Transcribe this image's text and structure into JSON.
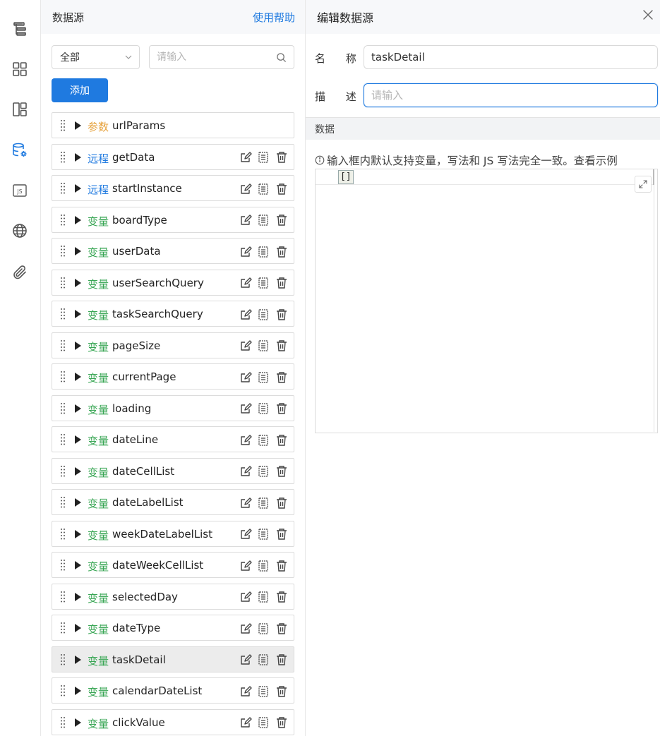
{
  "rail": {
    "icons": [
      "outline-tree-icon",
      "components-grid-icon",
      "layout-icon",
      "datasource-icon",
      "js-icon",
      "globe-icon",
      "attachment-icon"
    ],
    "active": "datasource-icon",
    "active_color": "#1f7ae0"
  },
  "datasource_panel": {
    "title": "数据源",
    "help_link": "使用帮助",
    "filter_select": "全部",
    "search_placeholder": "请输入",
    "add_button": "添加",
    "items": [
      {
        "tag": "参数",
        "tag_type": "param",
        "name": "urlParams",
        "actions": false
      },
      {
        "tag": "远程",
        "tag_type": "remote",
        "name": "getData",
        "actions": true
      },
      {
        "tag": "远程",
        "tag_type": "remote",
        "name": "startInstance",
        "actions": true
      },
      {
        "tag": "变量",
        "tag_type": "var",
        "name": "boardType",
        "actions": true
      },
      {
        "tag": "变量",
        "tag_type": "var",
        "name": "userData",
        "actions": true
      },
      {
        "tag": "变量",
        "tag_type": "var",
        "name": "userSearchQuery",
        "actions": true
      },
      {
        "tag": "变量",
        "tag_type": "var",
        "name": "taskSearchQuery",
        "actions": true
      },
      {
        "tag": "变量",
        "tag_type": "var",
        "name": "pageSize",
        "actions": true
      },
      {
        "tag": "变量",
        "tag_type": "var",
        "name": "currentPage",
        "actions": true
      },
      {
        "tag": "变量",
        "tag_type": "var",
        "name": "loading",
        "actions": true
      },
      {
        "tag": "变量",
        "tag_type": "var",
        "name": "dateLine",
        "actions": true
      },
      {
        "tag": "变量",
        "tag_type": "var",
        "name": "dateCellList",
        "actions": true
      },
      {
        "tag": "变量",
        "tag_type": "var",
        "name": "dateLabelList",
        "actions": true
      },
      {
        "tag": "变量",
        "tag_type": "var",
        "name": "weekDateLabelList",
        "actions": true
      },
      {
        "tag": "变量",
        "tag_type": "var",
        "name": "dateWeekCellList",
        "actions": true
      },
      {
        "tag": "变量",
        "tag_type": "var",
        "name": "selectedDay",
        "actions": true
      },
      {
        "tag": "变量",
        "tag_type": "var",
        "name": "dateType",
        "actions": true
      },
      {
        "tag": "变量",
        "tag_type": "var",
        "name": "taskDetail",
        "actions": true,
        "selected": true
      },
      {
        "tag": "变量",
        "tag_type": "var",
        "name": "calendarDateList",
        "actions": true
      },
      {
        "tag": "变量",
        "tag_type": "var",
        "name": "clickValue",
        "actions": true
      }
    ]
  },
  "edit_panel": {
    "title": "编辑数据源",
    "name_label_1": "名",
    "name_label_2": "称",
    "name_value": "taskDetail",
    "desc_label_1": "描",
    "desc_label_2": "述",
    "desc_placeholder": "请输入",
    "data_section": "数据",
    "hint": "输入框内默认支持变量，写法和 JS 写法完全一致。查看示例",
    "editor_value": "[]"
  }
}
